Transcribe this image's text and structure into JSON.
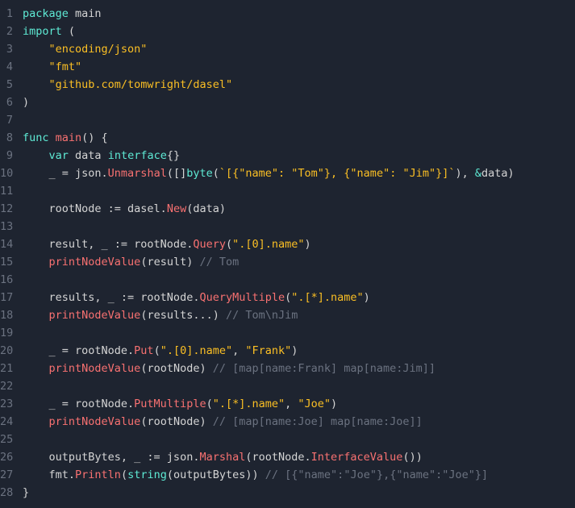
{
  "lines": [
    {
      "n": "1",
      "html": "<span class='kw'>package</span> <span class='pkg'>main</span>"
    },
    {
      "n": "2",
      "html": "<span class='kw'>import</span> ("
    },
    {
      "n": "3",
      "html": "    <span class='str'>\"encoding/json\"</span>"
    },
    {
      "n": "4",
      "html": "    <span class='str'>\"fmt\"</span>"
    },
    {
      "n": "5",
      "html": "    <span class='str'>\"github.com/tomwright/dasel\"</span>"
    },
    {
      "n": "6",
      "html": ")"
    },
    {
      "n": "7",
      "html": ""
    },
    {
      "n": "8",
      "html": "<span class='kw'>func</span> <span class='fn'>main</span>() {"
    },
    {
      "n": "9",
      "html": "    <span class='kw'>var</span> <span class='ident'>data</span> <span class='typ'>interface</span>{}"
    },
    {
      "n": "10",
      "html": "    _ = json.<span class='fn'>Unmarshal</span>([]<span class='kw'>byte</span>(<span class='str'>`[{\"name\": \"Tom\"}, {\"name\": \"Jim\"}]`</span>), <span class='amp'>&amp;</span>data)"
    },
    {
      "n": "11",
      "html": ""
    },
    {
      "n": "12",
      "html": "    rootNode := dasel.<span class='fn'>New</span>(data)"
    },
    {
      "n": "13",
      "html": ""
    },
    {
      "n": "14",
      "html": "    result, _ := rootNode.<span class='fn'>Query</span>(<span class='str'>\".[0].name\"</span>)"
    },
    {
      "n": "15",
      "html": "    <span class='fn'>printNodeValue</span>(result) <span class='cmt'>// Tom</span>"
    },
    {
      "n": "16",
      "html": ""
    },
    {
      "n": "17",
      "html": "    results, _ := rootNode.<span class='fn'>QueryMultiple</span>(<span class='str'>\".[*].name\"</span>)"
    },
    {
      "n": "18",
      "html": "    <span class='fn'>printNodeValue</span>(results...) <span class='cmt'>// Tom\\nJim</span>"
    },
    {
      "n": "19",
      "html": ""
    },
    {
      "n": "20",
      "html": "    _ = rootNode.<span class='fn'>Put</span>(<span class='str'>\".[0].name\"</span>, <span class='str'>\"Frank\"</span>)"
    },
    {
      "n": "21",
      "html": "    <span class='fn'>printNodeValue</span>(rootNode) <span class='cmt'>// [map[name:Frank] map[name:Jim]]</span>"
    },
    {
      "n": "22",
      "html": ""
    },
    {
      "n": "23",
      "html": "    _ = rootNode.<span class='fn'>PutMultiple</span>(<span class='str'>\".[*].name\"</span>, <span class='str'>\"Joe\"</span>)"
    },
    {
      "n": "24",
      "html": "    <span class='fn'>printNodeValue</span>(rootNode) <span class='cmt'>// [map[name:Joe] map[name:Joe]]</span>"
    },
    {
      "n": "25",
      "html": ""
    },
    {
      "n": "26",
      "html": "    outputBytes, _ := json.<span class='fn'>Marshal</span>(rootNode.<span class='fn'>InterfaceValue</span>())"
    },
    {
      "n": "27",
      "html": "    fmt.<span class='fn'>Println</span>(<span class='kw'>string</span>(outputBytes)) <span class='cmt'>// [{\"name\":\"Joe\"},{\"name\":\"Joe\"}]</span>"
    },
    {
      "n": "28",
      "html": "}"
    }
  ]
}
